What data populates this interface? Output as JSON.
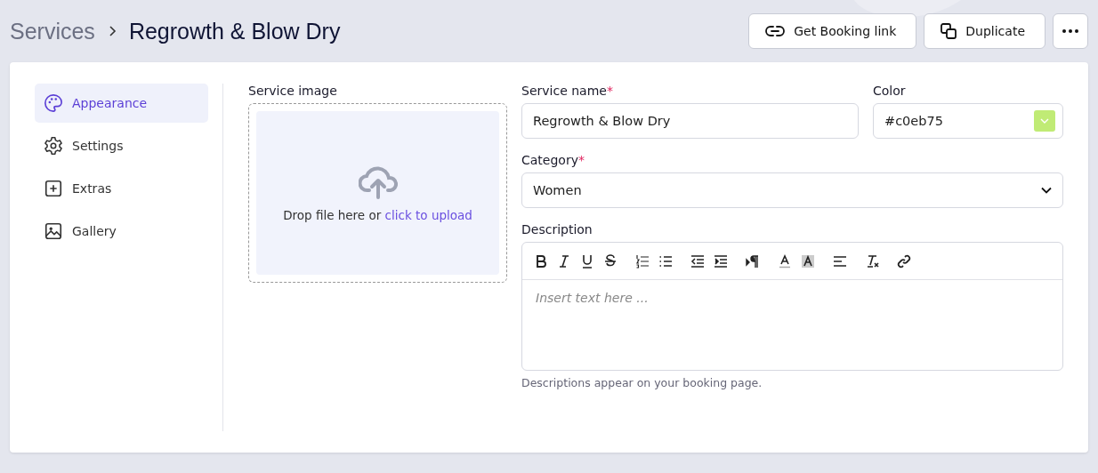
{
  "breadcrumb": {
    "parent": "Services",
    "current": "Regrowth & Blow Dry"
  },
  "actions": [
    {
      "kind": "link",
      "label": "Get Booking link"
    },
    {
      "kind": "duplicate",
      "label": "Duplicate"
    },
    {
      "kind": "more"
    }
  ],
  "sidebar": {
    "items": [
      {
        "kind": "palette",
        "label": "Appearance",
        "selected": true
      },
      {
        "kind": "gear",
        "label": "Settings",
        "selected": false
      },
      {
        "kind": "plus",
        "label": "Extras",
        "selected": false
      },
      {
        "kind": "image",
        "label": "Gallery",
        "selected": false
      }
    ]
  },
  "service_image": {
    "label": "Service image",
    "prompt": "Drop file here or",
    "link": "click to upload"
  },
  "service_name": {
    "label": "Service name",
    "required_mark": "*",
    "value": "Regrowth & Blow Dry"
  },
  "color": {
    "label": "Color",
    "value": "#c0eb75"
  },
  "category": {
    "label": "Category",
    "required_mark": "*",
    "value": "Women"
  },
  "description": {
    "label": "Description",
    "placeholder": "Insert text here ...",
    "hint": "Descriptions appear on your booking page.",
    "toolbar": [
      {
        "tools": [
          {
            "kind": "bold"
          },
          {
            "kind": "italic"
          },
          {
            "kind": "underline"
          },
          {
            "kind": "strikethrough"
          }
        ]
      },
      {
        "tools": [
          {
            "kind": "ordered-list"
          },
          {
            "kind": "bullet-list"
          }
        ]
      },
      {
        "tools": [
          {
            "kind": "outdent"
          },
          {
            "kind": "indent"
          }
        ]
      },
      {
        "tools": [
          {
            "kind": "text-direction"
          }
        ]
      },
      {
        "tools": [
          {
            "kind": "text-color"
          },
          {
            "kind": "highlight-color"
          }
        ]
      },
      {
        "tools": [
          {
            "kind": "align-left"
          }
        ]
      },
      {
        "tools": [
          {
            "kind": "clear-format"
          }
        ]
      },
      {
        "tools": [
          {
            "kind": "link"
          }
        ]
      }
    ]
  }
}
